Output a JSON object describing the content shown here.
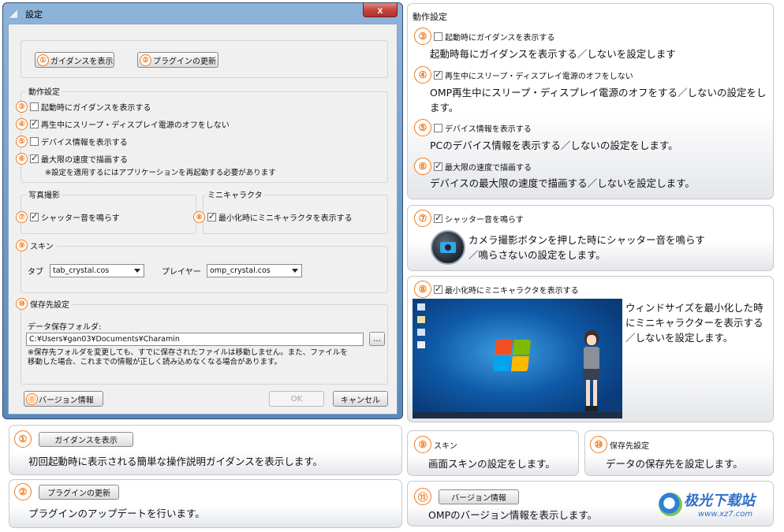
{
  "dialog": {
    "title": "設定",
    "btn_guidance": "ガイダンスを表示",
    "btn_plugin_update": "プラグインの更新",
    "group_behavior": "動作設定",
    "opt_guidance_startup": "起動時にガイダンスを表示する",
    "opt_no_sleep": "再生中にスリープ・ディスプレイ電源のオフをしない",
    "opt_device_info": "デバイス情報を表示する",
    "opt_max_speed": "最大限の速度で描画する",
    "note_restart": "※設定を適用するにはアプリケーションを再起動する必要があります",
    "group_photo": "写真撮影",
    "opt_shutter": "シャッター音を鳴らす",
    "group_mini": "ミニキャラクタ",
    "opt_mini_char": "最小化時にミニキャラクタを表示する",
    "group_skin": "スキン",
    "label_tab": "タブ",
    "tab_value": "tab_crystal.cos",
    "label_player": "プレイヤー",
    "player_value": "omp_crystal.cos",
    "group_save": "保存先設定",
    "label_data_folder": "データ保存フォルダ:",
    "folder_value": "C:¥Users¥gan03¥Documents¥Charamin",
    "btn_browse": "…",
    "note_save": "※保存先フォルダを変更しても、すでに保存されたファイルは移動しません。また、ファイルを移動した場合、これまでの情報が正しく読み込めなくなる場合があります。",
    "btn_version": "バージョン情報",
    "btn_ok": "OK",
    "btn_cancel": "キャンセル",
    "close_glyph": "x"
  },
  "markers": [
    "①",
    "②",
    "③",
    "④",
    "⑤",
    "⑥",
    "⑦",
    "⑧",
    "⑨",
    "⑩",
    "⑪"
  ],
  "right": {
    "behavior_title": "動作設定",
    "item3_label": "起動時にガイダンスを表示する",
    "item3_desc": "起動時毎にガイダンスを表示する／しないを設定します",
    "item4_label": "再生中にスリープ・ディスプレイ電源のオフをしない",
    "item4_desc": "OMP再生中にスリープ・ディスプレイ電源のオフをする／しないの設定をします。",
    "item5_label": "デバイス情報を表示する",
    "item5_desc": "PCのデバイス情報を表示する／しないの設定をします。",
    "item6_label": "最大限の速度で描画する",
    "item6_desc": "デバイスの最大限の速度で描画する／しないを設定します。",
    "item7_label": "シャッター音を鳴らす",
    "item7_desc": "カメラ撮影ボタンを押した時にシャッター音を鳴らす／鳴らさないの設定をします。",
    "item8_label": "最小化時にミニキャラクタを表示する",
    "item8_desc": "ウィンドサイズを最小化した時にミニキャラクターを表示する／しないを設定します。",
    "item9_title": "スキン",
    "item9_desc": "画面スキンの設定をします。",
    "item10_title": "保存先設定",
    "item10_desc": "データの保存先を設定します。",
    "item11_btn": "バージョン情報",
    "item11_desc": "OMPのバージョン情報を表示します。"
  },
  "bottom": {
    "item1_btn": "ガイダンスを表示",
    "item1_desc": "初回起動時に表示される簡単な操作説明ガイダンスを表示します。",
    "item2_btn": "プラグインの更新",
    "item2_desc": "プラグインのアップデートを行います。"
  },
  "watermark": {
    "site_name": "极光下载站",
    "site_url": "www.xz7.com"
  },
  "colors": {
    "marker": "#f2791c",
    "titlebar": "#5b8cc0",
    "close_button": "#c7463f"
  }
}
